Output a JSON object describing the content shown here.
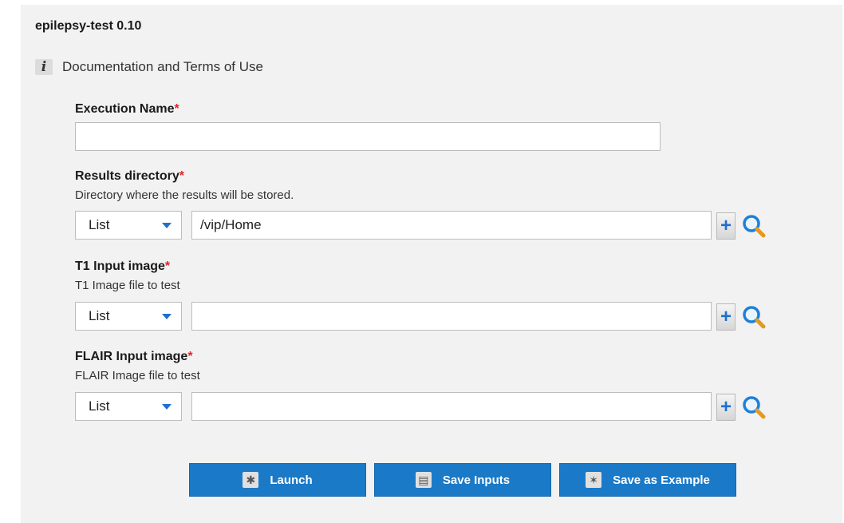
{
  "app": {
    "title": "epilepsy-test 0.10"
  },
  "documentation": {
    "label": "Documentation and Terms of Use",
    "icon": "info-icon"
  },
  "fields": {
    "execution_name": {
      "label": "Execution Name",
      "required_mark": "*",
      "value": ""
    },
    "results_directory": {
      "label": "Results directory",
      "required_mark": "*",
      "description": "Directory where the results will be stored.",
      "mode": "List",
      "value": "/vip/Home"
    },
    "t1_input": {
      "label": "T1 Input image",
      "required_mark": "*",
      "description": "T1 Image file to test",
      "mode": "List",
      "value": ""
    },
    "flair_input": {
      "label": "FLAIR Input image",
      "required_mark": "*",
      "description": "FLAIR Image file to test",
      "mode": "List",
      "value": ""
    }
  },
  "buttons": {
    "launch": {
      "label": "Launch",
      "icon": "gear-icon"
    },
    "save_inputs": {
      "label": "Save Inputs",
      "icon": "floppy-disk-icon"
    },
    "save_as_example": {
      "label": "Save as Example",
      "icon": "magic-wand-icon"
    }
  },
  "colors": {
    "accent": "#1a7ac8",
    "required": "#e8202a",
    "panel_bg": "#f2f2f2"
  }
}
